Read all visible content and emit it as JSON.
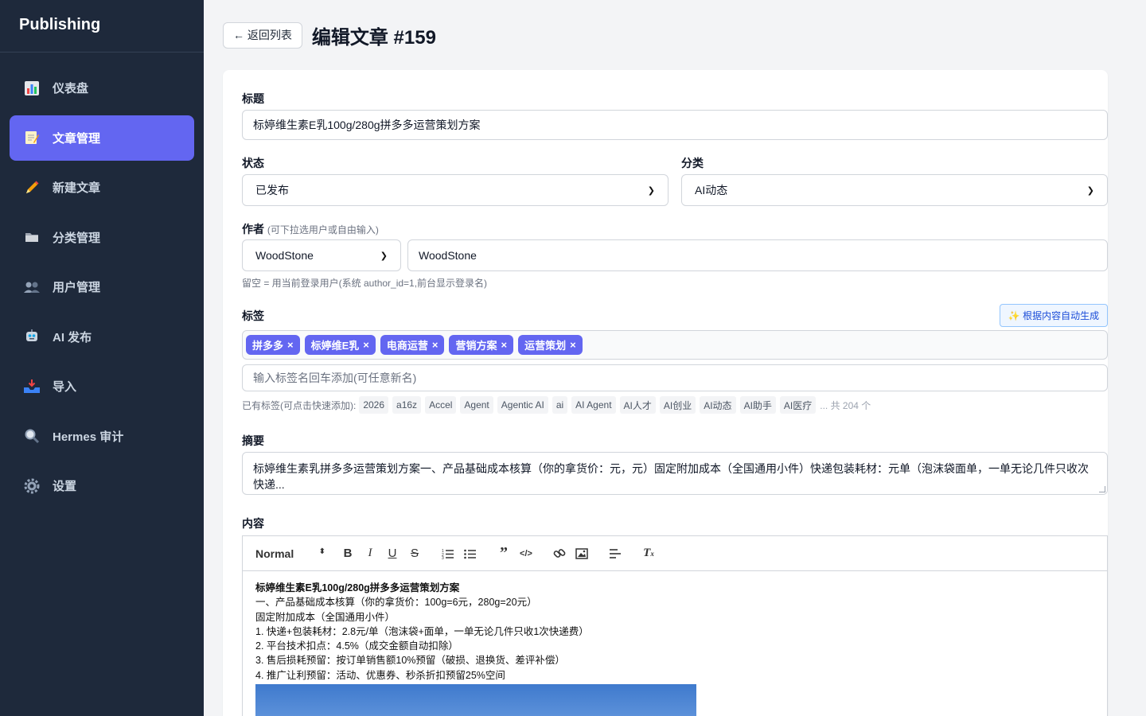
{
  "brand": "Publishing",
  "nav": [
    {
      "label": "仪表盘",
      "icon": "bar-chart-icon"
    },
    {
      "label": "文章管理",
      "icon": "memo-icon",
      "active": true
    },
    {
      "label": "新建文章",
      "icon": "pencil-icon"
    },
    {
      "label": "分类管理",
      "icon": "folder-icon"
    },
    {
      "label": "用户管理",
      "icon": "users-icon"
    },
    {
      "label": "AI 发布",
      "icon": "robot-icon"
    },
    {
      "label": "导入",
      "icon": "inbox-tray-icon"
    },
    {
      "label": "Hermes 审计",
      "icon": "magnifier-icon"
    },
    {
      "label": "设置",
      "icon": "gear-icon"
    }
  ],
  "back_label": "← 返回列表",
  "page_title": "编辑文章 #159",
  "form": {
    "title_label": "标题",
    "title_value": "标婷维生素E乳100g/280g拼多多运营策划方案",
    "status_label": "状态",
    "status_value": "已发布",
    "category_label": "分类",
    "category_value": "AI动态",
    "author_label": "作者",
    "author_hint": "(可下拉选用户或自由输入)",
    "author_select": "WoodStone",
    "author_input": "WoodStone",
    "author_note": "留空 = 用当前登录用户(系统 author_id=1,前台显示登录名)",
    "tags_label": "标签",
    "auto_btn": "✨ 根据内容自动生成",
    "tags": [
      "拼多多",
      "标婷维E乳",
      "电商运营",
      "营销方案",
      "运营策划"
    ],
    "tag_input_placeholder": "输入标签名回车添加(可任意新名)",
    "existing_label": "已有标签(可点击快速添加):",
    "existing_tags": [
      "2026",
      "a16z",
      "Accel",
      "Agent",
      "Agentic AI",
      "ai",
      "AI Agent",
      "AI人才",
      "AI创业",
      "AI动态",
      "AI助手",
      "AI医疗"
    ],
    "existing_more": "... 共 204 个",
    "summary_label": "摘要",
    "summary_value": "标婷维生素乳拼多多运营策划方案一、产品基础成本核算（你的拿货价：元，元）固定附加成本（全国通用小件）快递包装耗材：元单（泡沫袋面单，一单无论几件只收次快递...",
    "content_label": "内容",
    "toolbar_heading": "Normal",
    "content_lines": [
      "标婷维生素E乳100g/280g拼多多运营策划方案",
      "一、产品基础成本核算（你的拿货价：100g=6元，280g=20元）",
      "固定附加成本（全国通用小件）",
      "1. 快递+包装耗材：2.8元/单（泡沫袋+面单，一单无论几件只收1次快递费）",
      "2. 平台技术扣点：4.5%（成交金额自动扣除）",
      "3. 售后损耗预留：按订单销售额10%预留（破损、退换货、差评补偿）",
      "4. 推广让利预留：活动、优惠券、秒杀折扣预留25%空间"
    ]
  }
}
